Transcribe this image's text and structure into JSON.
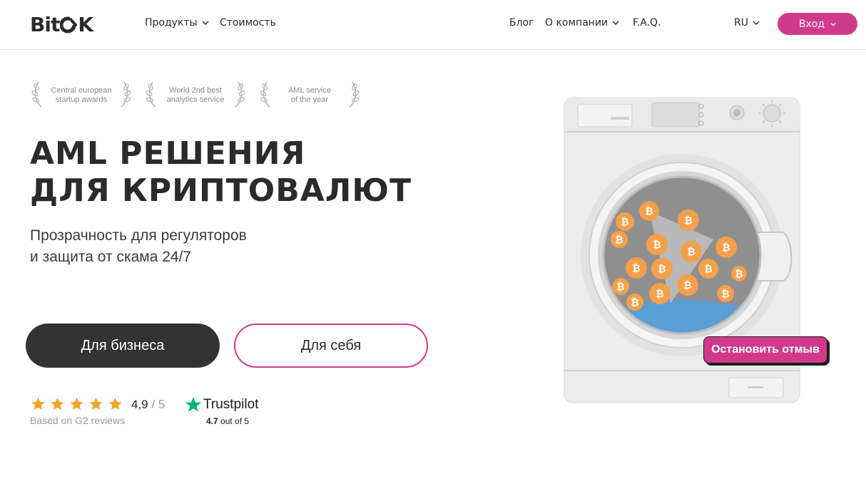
{
  "header": {
    "logo_text_left": "Bit",
    "logo_text_right": "K",
    "nav_left": [
      {
        "label": "Продукты",
        "has_dropdown": true
      },
      {
        "label": "Стоимость",
        "has_dropdown": false
      }
    ],
    "nav_right": [
      {
        "label": "Блог",
        "has_dropdown": false
      },
      {
        "label": "О компании",
        "has_dropdown": true
      },
      {
        "label": "F.A.Q.",
        "has_dropdown": false
      }
    ],
    "language": "RU",
    "login_label": "Вход"
  },
  "awards": [
    {
      "line1": "Central european",
      "line2": "startup awards"
    },
    {
      "line1": "World 2nd best",
      "line2": "analytics service"
    },
    {
      "line1": "AML service",
      "line2": "of the year"
    }
  ],
  "hero": {
    "title_line1": "AML РЕШЕНИЯ",
    "title_line2": "ДЛЯ КРИПТОВАЛЮТ",
    "subtitle_line1": "Прозрачность для регуляторов",
    "subtitle_line2": "и защита от скама 24/7",
    "btn_business": "Для бизнеса",
    "btn_self": "Для себя"
  },
  "rating": {
    "stars": 5,
    "score": "4,9",
    "max": "/ 5",
    "source": "Based on G2 reviews"
  },
  "trustpilot": {
    "name": "Trustpilot",
    "score": "4.7",
    "suffix": "out of 5"
  },
  "illustration": {
    "stop_button": "Остановить отмыв",
    "icon": "washing-machine-with-bitcoins"
  },
  "colors": {
    "accent": "#d13a8c",
    "dark": "#333333",
    "star": "#f2a52b",
    "trustpilot_green": "#00b67a",
    "bitcoin": "#f5a04a"
  }
}
